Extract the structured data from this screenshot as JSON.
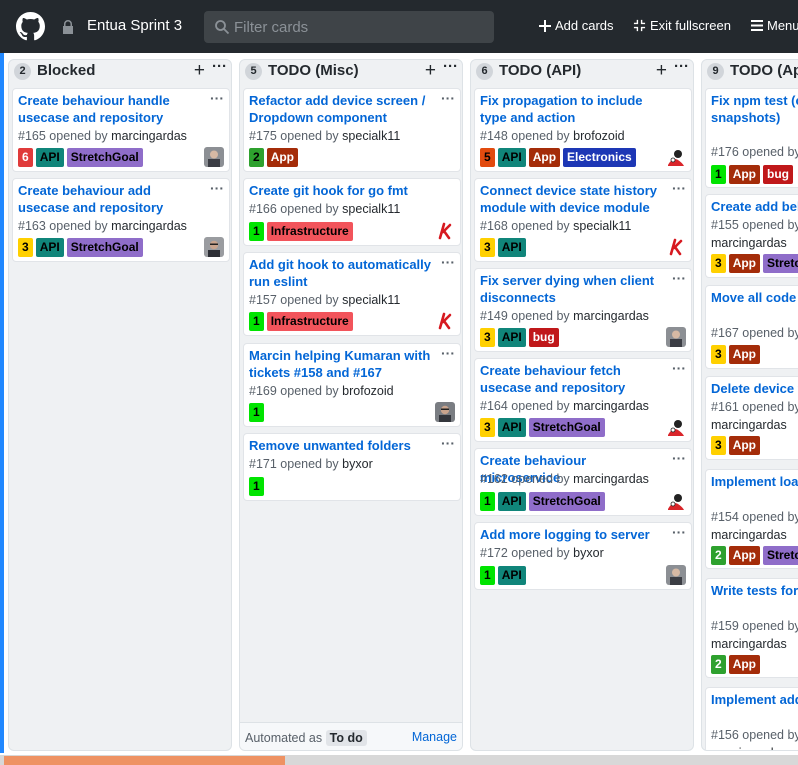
{
  "header": {
    "project_title": "Entua Sprint 3",
    "filter_placeholder": "Filter cards",
    "add_cards": "Add cards",
    "exit_fullscreen": "Exit fullscreen",
    "menu": "Menu"
  },
  "columns": [
    {
      "count": "2",
      "name": "Blocked",
      "cards": [
        {
          "title": "Create behaviour handle usecase and repository",
          "number": "#165",
          "opened_by": "opened by",
          "user": "marcingardas",
          "labels": [
            "6",
            "API",
            "StretchGoal"
          ],
          "avatar": "avatar-photo"
        },
        {
          "title": "Create behaviour add usecase and repository",
          "number": "#163",
          "opened_by": "opened by",
          "user": "marcingardas",
          "labels": [
            "3",
            "API",
            "StretchGoal"
          ],
          "avatar": "avatar-photo"
        }
      ]
    },
    {
      "count": "5",
      "name": "TODO (Misc)",
      "cards": [
        {
          "title": "Refactor add device screen / Dropdown component",
          "number": "#175",
          "opened_by": "opened by",
          "user": "specialk11",
          "labels": [
            "2",
            "App"
          ],
          "avatar": ""
        },
        {
          "title": "Create git hook for go fmt",
          "number": "#166",
          "opened_by": "opened by",
          "user": "specialk11",
          "labels": [
            "1",
            "Infrastructure"
          ],
          "avatar": "k-logo"
        },
        {
          "title": "Add git hook to automatically run eslint",
          "number": "#157",
          "opened_by": "opened by",
          "user": "specialk11",
          "labels": [
            "1",
            "Infrastructure"
          ],
          "avatar": "k-logo"
        },
        {
          "title": "Marcin helping Kumaran with tickets #158 and #167",
          "number": "#169",
          "opened_by": "opened by",
          "user": "brofozoid",
          "labels": [
            "1"
          ],
          "avatar": "avatar-photo"
        },
        {
          "title": "Remove unwanted folders",
          "number": "#171",
          "opened_by": "opened by",
          "user": "byxor",
          "labels": [
            "1"
          ],
          "avatar": ""
        }
      ],
      "footer": {
        "automated_as": "Automated as",
        "status": "To do",
        "manage": "Manage"
      }
    },
    {
      "count": "6",
      "name": "TODO (API)",
      "cards": [
        {
          "title": "Fix propagation to include type and action",
          "number": "#148",
          "opened_by": "opened by",
          "user": "brofozoid",
          "labels": [
            "5",
            "API",
            "App",
            "Electronics"
          ],
          "avatar": "cartoon"
        },
        {
          "title": "Connect device state history module with device module",
          "number": "#168",
          "opened_by": "opened by",
          "user": "specialk11",
          "labels": [
            "3",
            "API"
          ],
          "avatar": "k-logo"
        },
        {
          "title": "Fix server dying when client disconnects",
          "number": "#149",
          "opened_by": "opened by",
          "user": "marcingardas",
          "labels": [
            "3",
            "API",
            "bug"
          ],
          "avatar": "avatar-photo"
        },
        {
          "title": "Create behaviour fetch usecase and repository",
          "number": "#164",
          "opened_by": "opened by",
          "user": "marcingardas",
          "labels": [
            "3",
            "API",
            "StretchGoal"
          ],
          "avatar": "cartoon"
        },
        {
          "title": "Create behaviour microservice",
          "number": "#162",
          "opened_by": "opened by",
          "user": "marcingardas",
          "labels": [
            "1",
            "API",
            "StretchGoal"
          ],
          "avatar": "cartoon"
        },
        {
          "title": "Add more logging to server",
          "number": "#172",
          "opened_by": "opened by",
          "user": "byxor",
          "labels": [
            "1",
            "API"
          ],
          "avatar": "avatar-photo"
        }
      ]
    },
    {
      "count": "9",
      "name": "TODO (Ap",
      "cards": [
        {
          "title": "Fix npm test (component/sc snapshots)",
          "number": "#176",
          "opened_by": "opened by",
          "user": "",
          "labels": [
            "1",
            "App",
            "bug"
          ],
          "avatar": ""
        },
        {
          "title": "Create add beh",
          "number": "#155",
          "opened_by": "opened by",
          "user": "marcingardas",
          "labels": [
            "3",
            "App",
            "Stretc"
          ],
          "avatar": ""
        },
        {
          "title": "Move all code t within Redux",
          "number": "#167",
          "opened_by": "opened by",
          "user": "",
          "labels": [
            "3",
            "App"
          ],
          "avatar": ""
        },
        {
          "title": "Delete device fu",
          "number": "#161",
          "opened_by": "opened by",
          "user": "marcingardas",
          "labels": [
            "3",
            "App"
          ],
          "avatar": ""
        },
        {
          "title": "Implement load behaviours list",
          "number": "#154",
          "opened_by": "opened by",
          "user": "marcingardas",
          "labels": [
            "2",
            "App",
            "Stretc"
          ],
          "avatar": ""
        },
        {
          "title": "Write tests for e reducers",
          "number": "#159",
          "opened_by": "opened by",
          "user": "marcingardas",
          "labels": [
            "2",
            "App"
          ],
          "avatar": ""
        },
        {
          "title": "Implement add behaviours with",
          "number": "#156",
          "opened_by": "opened by",
          "user": "marcingardas",
          "labels": [],
          "avatar": ""
        }
      ]
    }
  ],
  "label_colors": {
    "1": "#00e400",
    "2": "#2ea12e",
    "3": "#ffd000",
    "5": "#e24b0f",
    "6": "#e03b3b",
    "API": "#10857a",
    "App": "#a42c09",
    "StretchGoal": "#8f6dc9",
    "Stretc": "#8f6dc9",
    "Infrastructure": "#f2545b",
    "bug": "#c0181a",
    "Electronics": "#1d37b5"
  }
}
